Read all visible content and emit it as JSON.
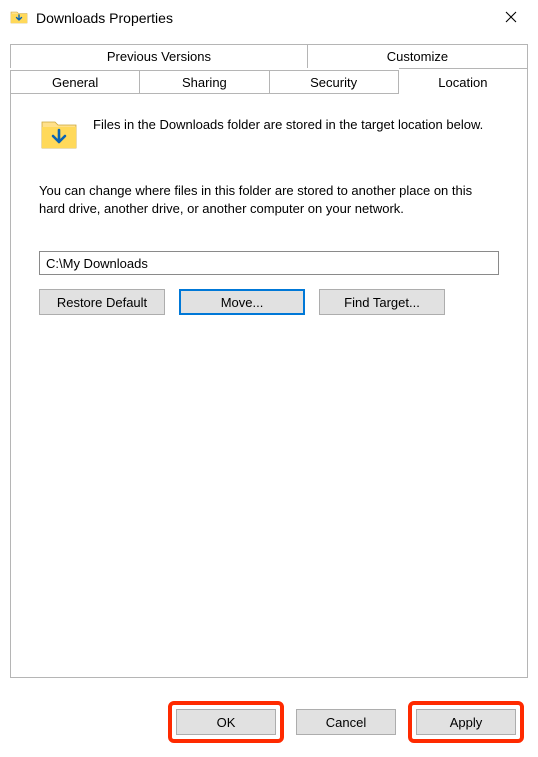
{
  "title": "Downloads Properties",
  "tabs": {
    "row1": [
      "Previous Versions",
      "Customize"
    ],
    "row2": [
      "General",
      "Sharing",
      "Security",
      "Location"
    ],
    "active": "Location"
  },
  "panel": {
    "description": "Files in the Downloads folder are stored in the target location below.",
    "change_text": "You can change where files in this folder are stored to another place on this hard drive, another drive, or another computer on your network.",
    "path_value": "C:\\My Downloads",
    "buttons": {
      "restore": "Restore Default",
      "move": "Move...",
      "find": "Find Target..."
    }
  },
  "footer": {
    "ok": "OK",
    "cancel": "Cancel",
    "apply": "Apply"
  },
  "icons": {
    "title_icon": "downloads-folder-icon",
    "close_icon": "close-icon",
    "panel_folder_icon": "downloads-folder-large-icon"
  }
}
